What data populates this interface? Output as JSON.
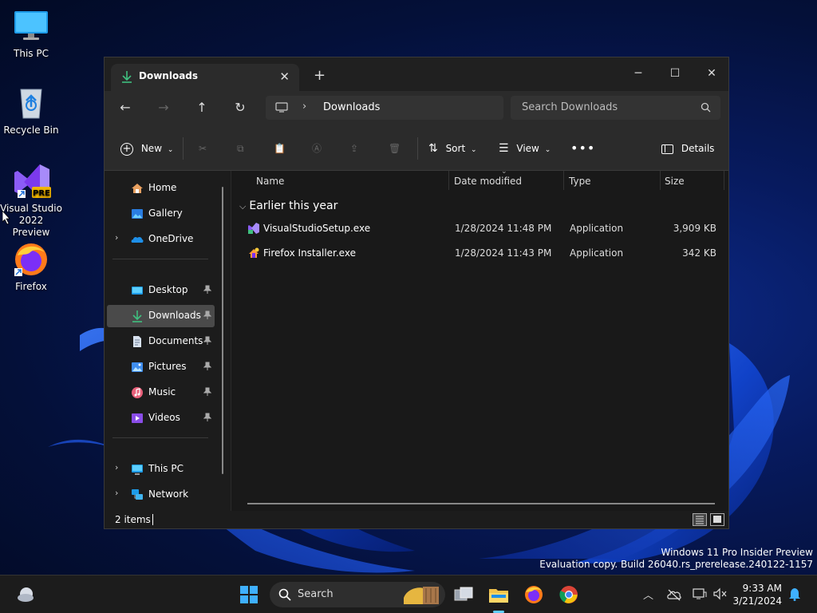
{
  "desktop": {
    "icons": [
      {
        "label": "This PC"
      },
      {
        "label": "Recycle Bin"
      },
      {
        "label": "Visual Studio 2022 Preview",
        "line1": "Visual Studio",
        "line2": "2022 Preview",
        "badge": "PRE"
      },
      {
        "label": "Firefox"
      }
    ],
    "watermark": {
      "line1": "Windows 11 Pro Insider Preview",
      "line2": "Evaluation copy. Build 26040.rs_prerelease.240122-1157"
    }
  },
  "explorer": {
    "tab_title": "Downloads",
    "address_path": "Downloads",
    "search_placeholder": "Search Downloads",
    "toolbar": {
      "new_label": "New",
      "sort_label": "Sort",
      "view_label": "View",
      "details_label": "Details"
    },
    "sidebar": {
      "items": [
        {
          "label": "Home",
          "icon": "home-icon"
        },
        {
          "label": "Gallery",
          "icon": "gallery-icon"
        },
        {
          "label": "OneDrive",
          "icon": "onedrive-icon"
        },
        {
          "label": "Desktop",
          "icon": "desktop-icon"
        },
        {
          "label": "Downloads",
          "icon": "downloads-icon"
        },
        {
          "label": "Documents",
          "icon": "documents-icon"
        },
        {
          "label": "Pictures",
          "icon": "pictures-icon"
        },
        {
          "label": "Music",
          "icon": "music-icon"
        },
        {
          "label": "Videos",
          "icon": "videos-icon"
        },
        {
          "label": "This PC",
          "icon": "this-pc-icon"
        },
        {
          "label": "Network",
          "icon": "network-icon"
        }
      ]
    },
    "columns": {
      "name": "Name",
      "date": "Date modified",
      "type": "Type",
      "size": "Size"
    },
    "group_label": "Earlier this year",
    "files": [
      {
        "name": "VisualStudioSetup.exe",
        "date": "1/28/2024 11:48 PM",
        "type": "Application",
        "size": "3,909 KB"
      },
      {
        "name": "Firefox Installer.exe",
        "date": "1/28/2024 11:43 PM",
        "type": "Application",
        "size": "342 KB"
      }
    ],
    "status_count": "2 items"
  },
  "taskbar": {
    "search_label": "Search",
    "time": "9:33 AM",
    "date": "3/21/2024"
  },
  "colors": {
    "accent": "#60cdff",
    "selected": "#4a4a4a"
  }
}
